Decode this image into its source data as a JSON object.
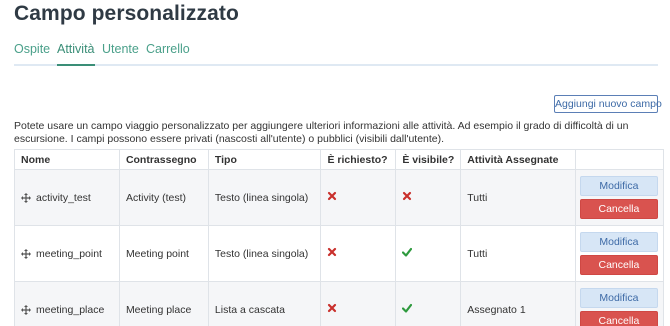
{
  "page": {
    "title": "Campo personalizzato"
  },
  "tabs": [
    {
      "label": "Ospite",
      "active": false
    },
    {
      "label": "Attività",
      "active": true
    },
    {
      "label": "Utente",
      "active": false
    },
    {
      "label": "Carrello",
      "active": false
    }
  ],
  "toolbar": {
    "add_label": "Aggiungi nuovo campo"
  },
  "description": "Potete usare un campo viaggio personalizzato per aggiungere ulteriori informazioni alle attività. Ad esempio il grado di difficoltà di un escursione. I campi possono essere privati (nascosti all'utente) o pubblici (visibili dall'utente).",
  "table": {
    "headers": [
      "Nome",
      "Contrassegno",
      "Tipo",
      "È richiesto?",
      "È visibile?",
      "Attività Assegnate",
      ""
    ],
    "rows": [
      {
        "name": "activity_test",
        "tag": "Activity (test)",
        "type": "Testo (linea singola)",
        "required": false,
        "visible": false,
        "assigned": "Tutti",
        "edit": "Modifica",
        "delete": "Cancella"
      },
      {
        "name": "meeting_point",
        "tag": "Meeting point",
        "type": "Testo (linea singola)",
        "required": false,
        "visible": true,
        "assigned": "Tutti",
        "edit": "Modifica",
        "delete": "Cancella"
      },
      {
        "name": "meeting_place",
        "tag": "Meeting place",
        "type": "Lista a cascata",
        "required": false,
        "visible": true,
        "assigned": "Assegnato 1",
        "edit": "Modifica",
        "delete": "Cancella"
      }
    ]
  },
  "colors": {
    "accent": "#3a8e77",
    "danger": "#d9534f",
    "primary_light": "#d7e6f6",
    "check": "#2e9a3e",
    "cross": "#c9302c"
  },
  "icons": {
    "move": "move-icon",
    "yes": "check-icon",
    "no": "cross-icon"
  }
}
